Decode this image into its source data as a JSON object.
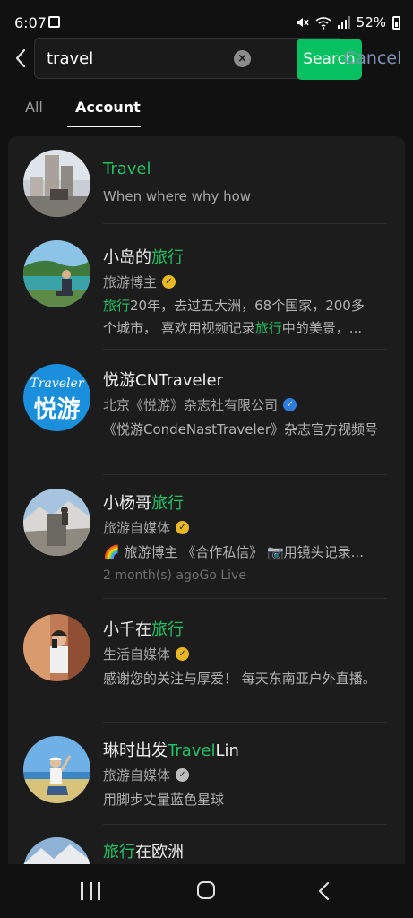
{
  "status": {
    "time": "6:07",
    "battery": "52%"
  },
  "search": {
    "query": "travel",
    "button": "Search",
    "cancel": "Cancel"
  },
  "tabs": [
    {
      "label": "All",
      "active": false
    },
    {
      "label": "Account",
      "active": true
    }
  ],
  "accent": "#21c063",
  "results": [
    {
      "title_pre": "",
      "title_hl": "Travel",
      "title_post": "",
      "subtitle": "When where why how"
    },
    {
      "title_pre": "小岛的",
      "title_hl": "旅行",
      "title_post": "",
      "subtitle": "旅游博主",
      "badge": "gold",
      "desc_line1_hl": "旅行",
      "desc_line1_rest": "20年，去过五大洲，68个国家，200多",
      "desc_line2_pre": "个城市， 喜欢用视频记录",
      "desc_line2_hl": "旅行",
      "desc_line2_post": "中的美景，..."
    },
    {
      "title_pre": "悦游CNTraveler",
      "title_hl": "",
      "title_post": "",
      "subtitle": "北京《悦游》杂志社有限公司",
      "badge": "blue",
      "desc": "《悦游CondeNastTraveler》杂志官方视频号"
    },
    {
      "title_pre": "小杨哥",
      "title_hl": "旅行",
      "title_post": "",
      "subtitle": "旅游自媒体",
      "badge": "gold",
      "desc": "🌈 旅游博主 《合作私信》 📷用镜头记录...",
      "meta": "2 month(s) agoGo Live"
    },
    {
      "title_pre": "小千在",
      "title_hl": "旅行",
      "title_post": "",
      "subtitle": "生活自媒体",
      "badge": "gold",
      "desc": "感谢您的关注与厚爱！ 每天东南亚户外直播。"
    },
    {
      "title_pre": "琳时出发",
      "title_hl": "Travel",
      "title_post": "Lin",
      "subtitle": "旅游自媒体",
      "badge": "grey",
      "desc": "用脚步丈量蓝色星球"
    },
    {
      "title_pre": "",
      "title_hl": "旅行",
      "title_post": "在欧洲"
    }
  ],
  "avatar_logo_text": {
    "top": "Traveler",
    "bottom": "悦游"
  }
}
